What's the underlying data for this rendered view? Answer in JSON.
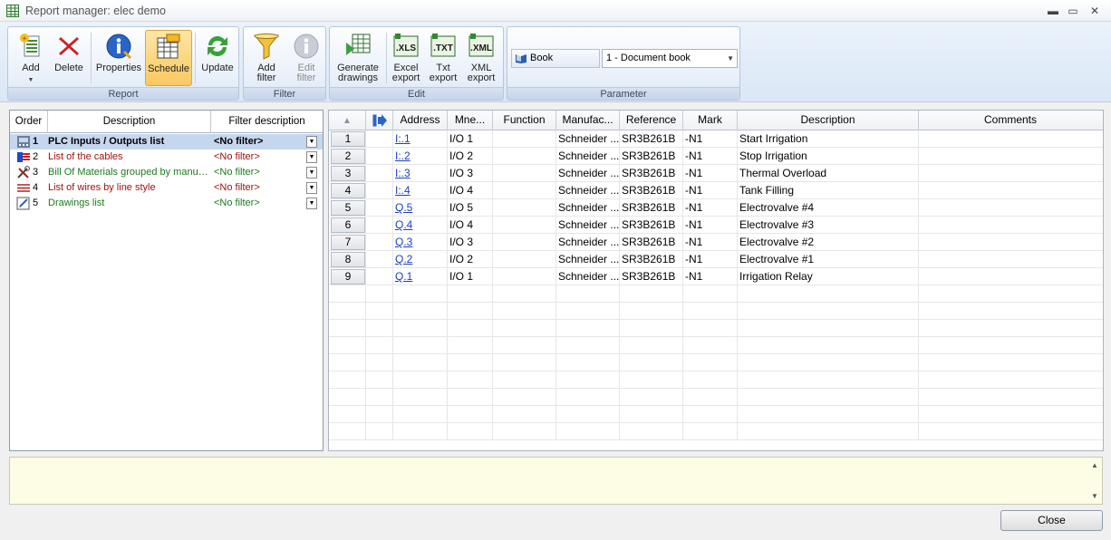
{
  "window": {
    "title": "Report manager: elec demo",
    "minimize": "▬",
    "restore": "▭",
    "close": "✕"
  },
  "ribbon": {
    "groups": {
      "report": "Report",
      "filter": "Filter",
      "edit": "Edit",
      "parameter": "Parameter"
    },
    "buttons": {
      "add": "Add",
      "delete": "Delete",
      "properties": "Properties",
      "schedule": "Schedule",
      "update": "Update",
      "add_filter_1": "Add",
      "add_filter_2": "filter",
      "edit_filter_1": "Edit",
      "edit_filter_2": "filter",
      "generate_1": "Generate",
      "generate_2": "drawings",
      "excel_1": "Excel",
      "excel_2": "export",
      "txt_1": "Txt",
      "txt_2": "export",
      "xml_1": "XML",
      "xml_2": "export"
    },
    "parameter": {
      "book_label": "Book",
      "book_value": "1 - Document book"
    }
  },
  "report_list": {
    "headers": {
      "order": "Order",
      "description": "Description",
      "filter": "Filter description"
    },
    "rows": [
      {
        "order": "1",
        "description": "PLC Inputs / Outputs list",
        "filter": "<No filter>",
        "color": "#000000",
        "icon": "plc-icon"
      },
      {
        "order": "2",
        "description": "List of the cables",
        "filter": "<No filter>",
        "color": "#a01010",
        "icon": "cable-icon"
      },
      {
        "order": "3",
        "description": "Bill Of Materials grouped by manufacturer",
        "filter": "<No filter>",
        "color": "#1c7a1c",
        "icon": "tools-icon"
      },
      {
        "order": "4",
        "description": "List of wires by line style",
        "filter": "<No filter>",
        "color": "#a01010",
        "icon": "wires-icon"
      },
      {
        "order": "5",
        "description": "Drawings list",
        "filter": "<No filter>",
        "color": "#1c7a1c",
        "icon": "drawing-icon"
      }
    ]
  },
  "grid": {
    "headers": [
      "Address",
      "Mne...",
      "Function",
      "Manufac...",
      "Reference",
      "Mark",
      "Description",
      "Comments"
    ],
    "rows": [
      {
        "num": "1",
        "address": "I:.1",
        "mne": "I/O 1",
        "function": "",
        "manufacturer": "Schneider ...",
        "reference": "SR3B261B",
        "mark": "-N1",
        "description": "Start Irrigation",
        "comments": ""
      },
      {
        "num": "2",
        "address": "I:.2",
        "mne": "I/O 2",
        "function": "",
        "manufacturer": "Schneider ...",
        "reference": "SR3B261B",
        "mark": "-N1",
        "description": "Stop Irrigation",
        "comments": ""
      },
      {
        "num": "3",
        "address": "I:.3",
        "mne": "I/O 3",
        "function": "",
        "manufacturer": "Schneider ...",
        "reference": "SR3B261B",
        "mark": "-N1",
        "description": "Thermal Overload",
        "comments": ""
      },
      {
        "num": "4",
        "address": "I:.4",
        "mne": "I/O 4",
        "function": "",
        "manufacturer": "Schneider ...",
        "reference": "SR3B261B",
        "mark": "-N1",
        "description": "Tank Filling",
        "comments": ""
      },
      {
        "num": "5",
        "address": "Q.5",
        "mne": "I/O 5",
        "function": "",
        "manufacturer": "Schneider ...",
        "reference": "SR3B261B",
        "mark": "-N1",
        "description": "Electrovalve #4",
        "comments": ""
      },
      {
        "num": "6",
        "address": "Q.4",
        "mne": "I/O 4",
        "function": "",
        "manufacturer": "Schneider ...",
        "reference": "SR3B261B",
        "mark": "-N1",
        "description": "Electrovalve #3",
        "comments": ""
      },
      {
        "num": "7",
        "address": "Q.3",
        "mne": "I/O 3",
        "function": "",
        "manufacturer": "Schneider ...",
        "reference": "SR3B261B",
        "mark": "-N1",
        "description": "Electrovalve #2",
        "comments": ""
      },
      {
        "num": "8",
        "address": "Q.2",
        "mne": "I/O 2",
        "function": "",
        "manufacturer": "Schneider ...",
        "reference": "SR3B261B",
        "mark": "-N1",
        "description": "Electrovalve #1",
        "comments": ""
      },
      {
        "num": "9",
        "address": "Q.1",
        "mne": "I/O 1",
        "function": "",
        "manufacturer": "Schneider ...",
        "reference": "SR3B261B",
        "mark": "-N1",
        "description": "Irrigation Relay",
        "comments": ""
      }
    ]
  },
  "footer": {
    "close_label": "Close"
  }
}
